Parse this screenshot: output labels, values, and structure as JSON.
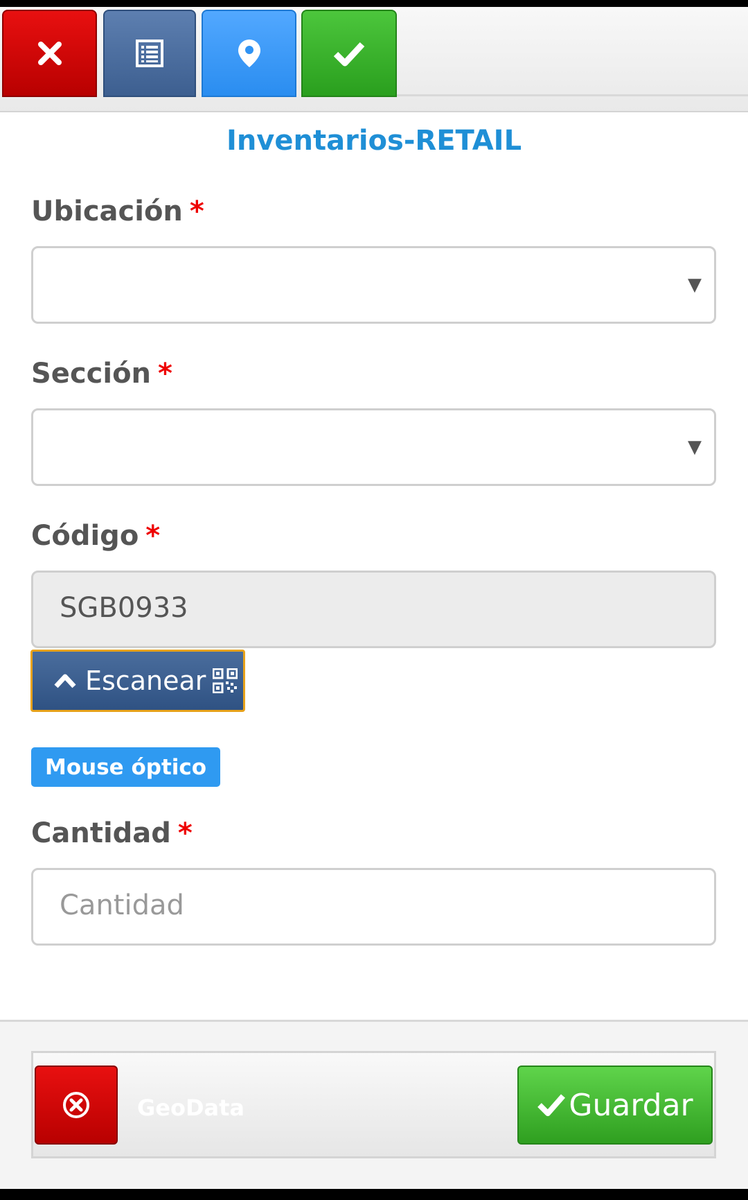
{
  "form_title": "Inventarios-RETAIL",
  "required_marker": "*",
  "fields": {
    "ubicacion": {
      "label": "Ubicación",
      "value": "",
      "arrow": "▼"
    },
    "seccion": {
      "label": "Sección",
      "value": "",
      "arrow": "▼"
    },
    "codigo": {
      "label": "Código",
      "value": "SGB0933"
    },
    "cantidad": {
      "label": "Cantidad",
      "placeholder": "Cantidad",
      "value": ""
    }
  },
  "scan_button": {
    "label": "Escanear",
    "icons": [
      "chevron-up-icon",
      "qr-code-icon"
    ]
  },
  "mouse_badge": "Mouse óptico",
  "footer": {
    "geodata_label": "GeoData",
    "save_label": "Guardar"
  },
  "toolbar_icons": [
    "close-icon",
    "list-icon",
    "location-pin-icon",
    "check-icon"
  ],
  "colors": {
    "title": "#1f8fd6",
    "required": "#ee0000",
    "close": "#d40000",
    "list": "#4a6d9d",
    "geo": "#3399ff",
    "ok": "#33aa22",
    "badge": "#2f9af1"
  }
}
